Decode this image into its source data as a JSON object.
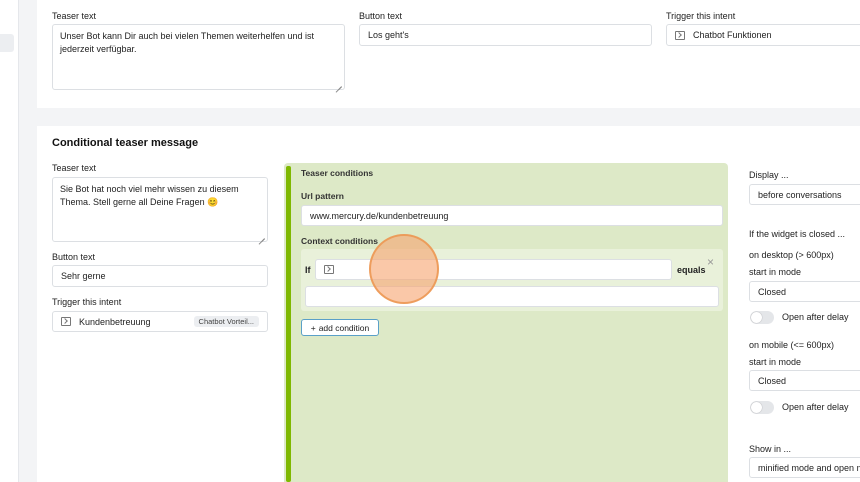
{
  "default_teaser": {
    "teaser_text_label": "Teaser text",
    "teaser_text_value": "Unser Bot kann Dir auch bei vielen Themen weiterhelfen und ist jederzeit verfügbar.",
    "button_text_label": "Button text",
    "button_text_value": "Los geht's",
    "trigger_label": "Trigger this intent",
    "trigger_value": "Chatbot Funktionen"
  },
  "conditional": {
    "title": "Conditional teaser message",
    "teaser_text_label": "Teaser text",
    "teaser_text_value": "Sie Bot hat noch viel mehr wissen zu diesem Thema. Stell gerne all Deine Fragen 😊",
    "button_text_label": "Button text",
    "button_text_value": "Sehr gerne",
    "trigger_label": "Trigger this intent",
    "trigger_value": "Kundenbetreuung",
    "trigger_tag": "Chatbot Vorteil..."
  },
  "conditions": {
    "title": "Teaser conditions",
    "url_label": "Url pattern",
    "url_value": "www.mercury.de/kundenbetreuung",
    "context_label": "Context conditions",
    "if_label": "If",
    "equals_label": "equals",
    "close_symbol": "×",
    "add_label": "add condition",
    "add_symbol": "+"
  },
  "display": {
    "display_label": "Display ...",
    "display_value": "before conversations",
    "closed_label": "If the widget is closed ...",
    "desktop_label": "on desktop (> 600px)",
    "desktop_mode_label": "start in mode",
    "desktop_mode_value": "Closed",
    "desktop_delay_label": "Open after delay",
    "mobile_label": "on mobile (<= 600px)",
    "mobile_mode_label": "start in mode",
    "mobile_mode_value": "Closed",
    "mobile_delay_label": "Open after delay",
    "show_in_label": "Show in ...",
    "show_in_value": "minified mode and open mo"
  }
}
